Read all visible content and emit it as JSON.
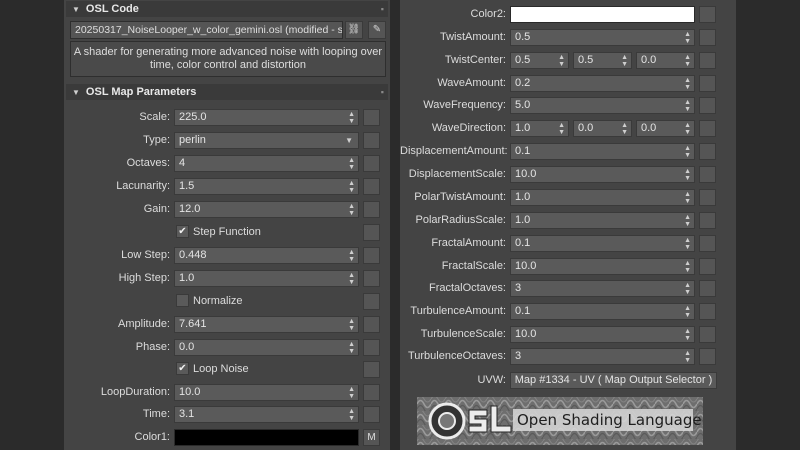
{
  "code_rollout": {
    "title": "OSL Code",
    "file_label": "20250317_NoiseLooper_w_color_gemini.osl (modified - st...",
    "description_line1": "A shader for generating more advanced noise with looping over",
    "description_line2": "time, color control and distortion",
    "link_icon": "link-icon",
    "edit_icon": "eyedropper-icon"
  },
  "params_rollout": {
    "title": "OSL Map Parameters",
    "scale": {
      "label": "Scale:",
      "value": "225.0"
    },
    "type": {
      "label": "Type:",
      "value": "perlin"
    },
    "octaves": {
      "label": "Octaves:",
      "value": "4"
    },
    "lacunarity": {
      "label": "Lacunarity:",
      "value": "1.5"
    },
    "gain": {
      "label": "Gain:",
      "value": "12.0"
    },
    "step_function": {
      "label": "Step Function",
      "checked": true
    },
    "low_step": {
      "label": "Low Step:",
      "value": "0.448"
    },
    "high_step": {
      "label": "High Step:",
      "value": "1.0"
    },
    "normalize": {
      "label": "Normalize",
      "checked": false
    },
    "amplitude": {
      "label": "Amplitude:",
      "value": "7.641"
    },
    "phase": {
      "label": "Phase:",
      "value": "0.0"
    },
    "loop_noise": {
      "label": "Loop Noise",
      "checked": true
    },
    "loop_duration": {
      "label": "LoopDuration:",
      "value": "10.0"
    },
    "time": {
      "label": "Time:",
      "value": "3.1"
    },
    "color1": {
      "label": "Color1:",
      "color": "#000000",
      "map_label": "M"
    }
  },
  "right": {
    "color2": {
      "label": "Color2:",
      "color": "#ffffff"
    },
    "twist_amount": {
      "label": "TwistAmount:",
      "value": "0.5"
    },
    "twist_center": {
      "label": "TwistCenter:",
      "x": "0.5",
      "y": "0.5",
      "z": "0.0"
    },
    "wave_amount": {
      "label": "WaveAmount:",
      "value": "0.2"
    },
    "wave_frequency": {
      "label": "WaveFrequency:",
      "value": "5.0"
    },
    "wave_direction": {
      "label": "WaveDirection:",
      "x": "1.0",
      "y": "0.0",
      "z": "0.0"
    },
    "displacement_amount": {
      "label": "DisplacementAmount:",
      "value": "0.1"
    },
    "displacement_scale": {
      "label": "DisplacementScale:",
      "value": "10.0"
    },
    "polar_twist_amount": {
      "label": "PolarTwistAmount:",
      "value": "1.0"
    },
    "polar_radius_scale": {
      "label": "PolarRadiusScale:",
      "value": "1.0"
    },
    "fractal_amount": {
      "label": "FractalAmount:",
      "value": "0.1"
    },
    "fractal_scale": {
      "label": "FractalScale:",
      "value": "10.0"
    },
    "fractal_octaves": {
      "label": "FractalOctaves:",
      "value": "3"
    },
    "turbulence_amount": {
      "label": "TurbulenceAmount:",
      "value": "0.1"
    },
    "turbulence_scale": {
      "label": "TurbulenceScale:",
      "value": "10.0"
    },
    "turbulence_octaves": {
      "label": "TurbulenceOctaves:",
      "value": "3"
    },
    "uvw": {
      "label": "UVW:",
      "value": "Map #1334 - UV  ( Map Output Selector )"
    }
  },
  "logo": {
    "text": "Open Shading Language",
    "mark": "OSL"
  }
}
